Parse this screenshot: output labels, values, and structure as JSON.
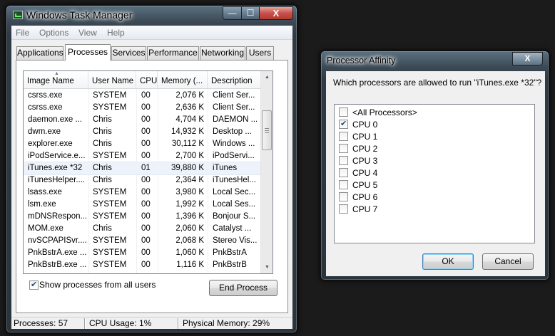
{
  "task_manager": {
    "title": "Windows Task Manager",
    "caption_buttons": {
      "minimize": "—",
      "maximize": "☐",
      "close": "X"
    },
    "menu": [
      "File",
      "Options",
      "View",
      "Help"
    ],
    "tabs": [
      "Applications",
      "Processes",
      "Services",
      "Performance",
      "Networking",
      "Users"
    ],
    "active_tab": "Processes",
    "columns": [
      "Image Name",
      "User Name",
      "CPU",
      "Memory (...",
      "Description"
    ],
    "sort_column": "Image Name",
    "processes": [
      [
        "csrss.exe",
        "SYSTEM",
        "00",
        "2,076 K",
        "Client Ser..."
      ],
      [
        "csrss.exe",
        "SYSTEM",
        "00",
        "2,636 K",
        "Client Ser..."
      ],
      [
        "daemon.exe ...",
        "Chris",
        "00",
        "4,704 K",
        "DAEMON ..."
      ],
      [
        "dwm.exe",
        "Chris",
        "00",
        "14,932 K",
        "Desktop ..."
      ],
      [
        "explorer.exe",
        "Chris",
        "00",
        "30,112 K",
        "Windows ..."
      ],
      [
        "iPodService.e...",
        "SYSTEM",
        "00",
        "2,700 K",
        "iPodServi..."
      ],
      [
        "iTunes.exe *32",
        "Chris",
        "01",
        "39,880 K",
        "iTunes"
      ],
      [
        "iTunesHelper....",
        "Chris",
        "00",
        "2,364 K",
        "iTunesHel..."
      ],
      [
        "lsass.exe",
        "SYSTEM",
        "00",
        "3,980 K",
        "Local Sec..."
      ],
      [
        "lsm.exe",
        "SYSTEM",
        "00",
        "1,992 K",
        "Local Ses..."
      ],
      [
        "mDNSRespon...",
        "SYSTEM",
        "00",
        "1,396 K",
        "Bonjour S..."
      ],
      [
        "MOM.exe",
        "Chris",
        "00",
        "2,060 K",
        "Catalyst ..."
      ],
      [
        "nvSCPAPISvr....",
        "SYSTEM",
        "00",
        "2,068 K",
        "Stereo Vis..."
      ],
      [
        "PnkBstrA.exe ...",
        "SYSTEM",
        "00",
        "1,060 K",
        "PnkBstrA"
      ],
      [
        "PnkBstrB.exe ...",
        "SYSTEM",
        "00",
        "1,116 K",
        "PnkBstrB"
      ]
    ],
    "selected_process": "iTunes.exe *32",
    "show_all_users": {
      "label": "Show processes from all users",
      "checked": true
    },
    "end_process_label": "End Process",
    "status": {
      "processes": "Processes: 57",
      "cpu": "CPU Usage: 1%",
      "memory": "Physical Memory: 29%"
    }
  },
  "affinity_dialog": {
    "title": "Processor Affinity",
    "close_label": "X",
    "question": "Which processors are allowed to run \"iTunes.exe *32\"?",
    "items": [
      {
        "label": "<All Processors>",
        "checked": false
      },
      {
        "label": "CPU 0",
        "checked": true
      },
      {
        "label": "CPU 1",
        "checked": false
      },
      {
        "label": "CPU 2",
        "checked": false
      },
      {
        "label": "CPU 3",
        "checked": false
      },
      {
        "label": "CPU 4",
        "checked": false
      },
      {
        "label": "CPU 5",
        "checked": false
      },
      {
        "label": "CPU 6",
        "checked": false
      },
      {
        "label": "CPU 7",
        "checked": false
      }
    ],
    "ok_label": "OK",
    "cancel_label": "Cancel"
  }
}
